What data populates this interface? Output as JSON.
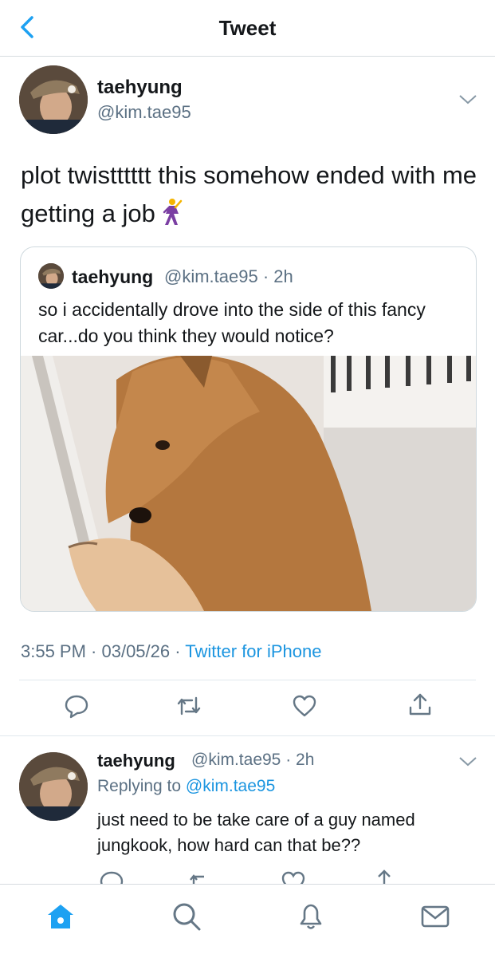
{
  "header": {
    "title": "Tweet",
    "back_icon": "chevron-left-icon",
    "accent": "#1da1f2"
  },
  "tweet": {
    "name": "taehyung",
    "handle": "@kim.tae95",
    "text": "plot twistttttt this somehow ended with me getting a job",
    "emoji": "man-dancing-icon",
    "timestamp": "3:55 PM · 03/05/26",
    "source_sep": "·",
    "source": "Twitter for iPhone"
  },
  "quote": {
    "name": "taehyung",
    "handle": "@kim.tae95 · 2h",
    "text": "so i accidentally drove into the side of this fancy car...do you think they would notice?"
  },
  "actions": [
    "reply-icon",
    "retweet-icon",
    "like-icon",
    "share-icon"
  ],
  "reply": {
    "name": "taehyung",
    "handle": "@kim.tae95 · 2h",
    "replying_prefix": "Replying to",
    "replying_to": "@kim.tae95",
    "text": "just need to be take care of a guy named jungkook, how hard can that be??"
  },
  "tabs": [
    "home-icon",
    "search-icon",
    "notifications-icon",
    "messages-icon"
  ],
  "colors": {
    "link": "#1b95e0",
    "secondary": "#5b7083",
    "active_tab": "#1da1f2"
  }
}
